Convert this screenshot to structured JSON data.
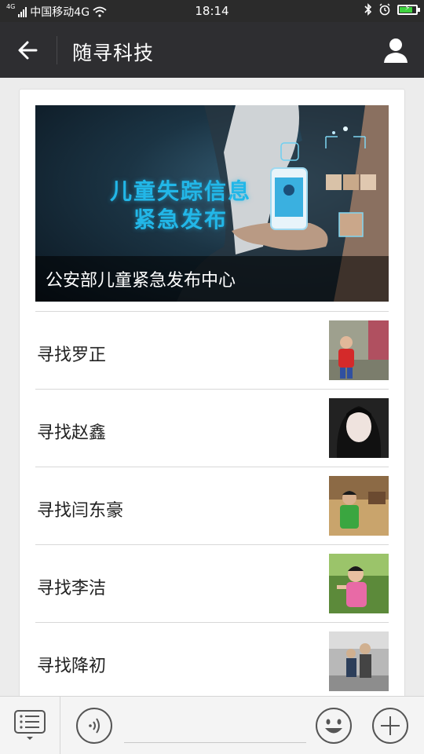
{
  "status_bar": {
    "network_small": "4G",
    "carrier": "中国移动4G",
    "time": "18:14",
    "battery_percent": 80,
    "icons": [
      "signal-icon",
      "wifi-icon",
      "bluetooth-icon",
      "alarm-icon",
      "battery-charging-icon"
    ]
  },
  "header": {
    "title": "随寻科技",
    "back_icon": "back-arrow-icon",
    "profile_icon": "user-profile-icon"
  },
  "banner": {
    "headline_line1": "儿童失踪信息",
    "headline_line2": "紧急发布",
    "caption": "公安部儿童紧急发布中心"
  },
  "articles": [
    {
      "title": "寻找罗正"
    },
    {
      "title": "寻找赵鑫"
    },
    {
      "title": "寻找闫东豪"
    },
    {
      "title": "寻找李洁"
    },
    {
      "title": "寻找降初"
    }
  ],
  "bottom_bar": {
    "icons": [
      "menu-list-icon",
      "voice-icon",
      "emoji-icon",
      "plus-icon"
    ]
  },
  "colors": {
    "status_bar_bg": "#2b2b2b",
    "title_bar_bg": "#2e2e31",
    "banner_text": "#22b7e8",
    "battery_green": "#3fd23f"
  }
}
